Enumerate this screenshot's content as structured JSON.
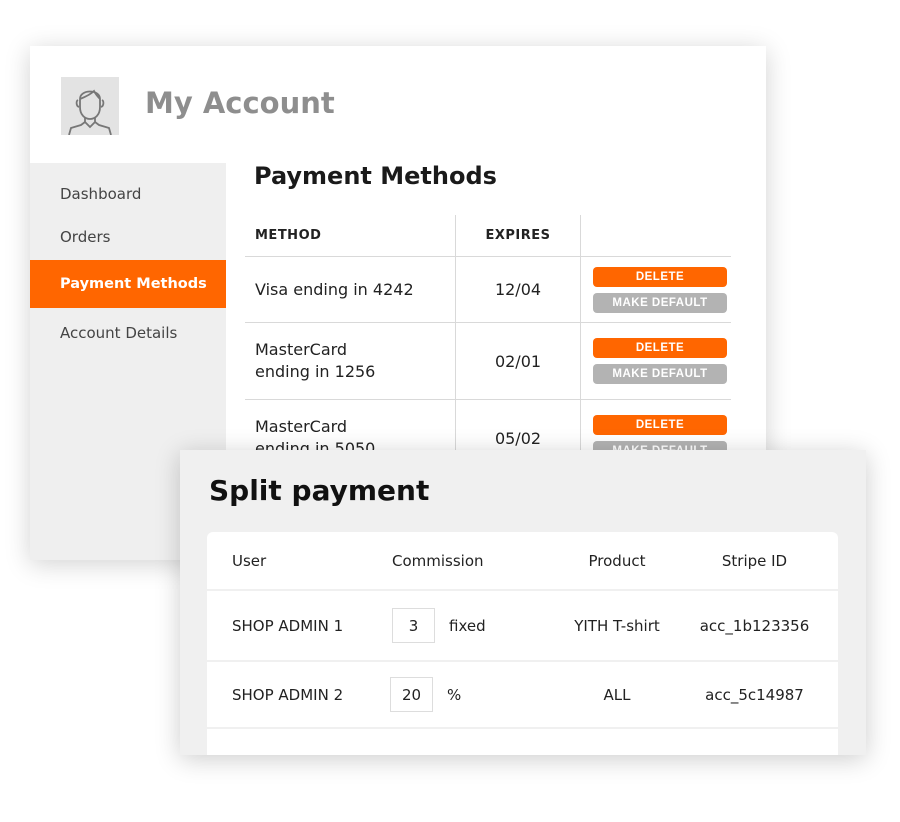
{
  "account": {
    "title": "My Account",
    "avatar_icon": "user-avatar-icon",
    "sidebar": [
      {
        "label": "Dashboard",
        "active": false
      },
      {
        "label": "Orders",
        "active": false
      },
      {
        "label": "Payment Methods",
        "active": true
      },
      {
        "label": "Account Details",
        "active": false
      }
    ],
    "accent_color": "#ff6600",
    "payment_methods": {
      "title": "Payment Methods",
      "headers": [
        "METHOD",
        "EXPIRES",
        ""
      ],
      "delete_label": "DELETE",
      "default_label": "MAKE DEFAULT",
      "rows": [
        {
          "method": "Visa ending in 4242",
          "expires": "12/04"
        },
        {
          "method": "MasterCard ending in 1256",
          "expires": "02/01"
        },
        {
          "method": "MasterCard ending in 5050",
          "expires": "05/02"
        }
      ]
    }
  },
  "split": {
    "title": "Split payment",
    "headers": [
      "User",
      "Commission",
      "Product",
      "Stripe ID"
    ],
    "rows": [
      {
        "user": "SHOP ADMIN 1",
        "commission": "3",
        "type": "fixed",
        "product": "YITH T-shirt",
        "stripe_id": "acc_1b123356"
      },
      {
        "user": "SHOP ADMIN 2",
        "commission": "20",
        "type": "%",
        "product": "ALL",
        "stripe_id": "acc_5c14987"
      }
    ]
  }
}
